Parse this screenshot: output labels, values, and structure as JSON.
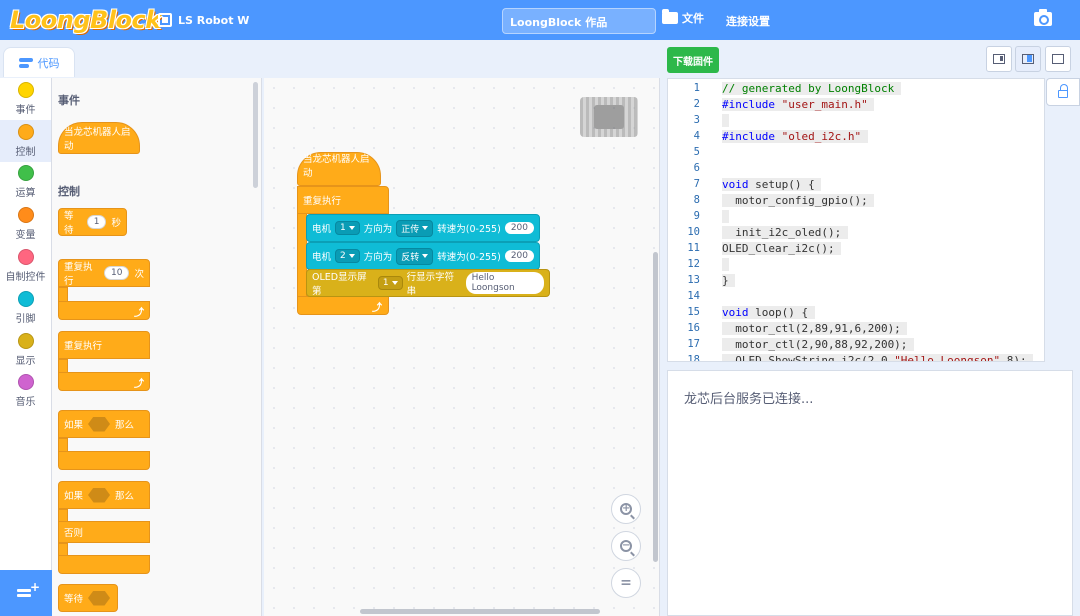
{
  "header": {
    "logo": "LoongBlock",
    "device": "LS Robot W",
    "project_title": "LoongBlock 作品",
    "file_label": "文件",
    "connect_label": "连接设置"
  },
  "tabs": {
    "code": "代码"
  },
  "categories": [
    {
      "label": "事件",
      "color": "#ffd500"
    },
    {
      "label": "控制",
      "color": "#ffab19"
    },
    {
      "label": "运算",
      "color": "#40bf4a"
    },
    {
      "label": "变量",
      "color": "#ff8c1a"
    },
    {
      "label": "自制控件",
      "color": "#ff6680"
    },
    {
      "label": "引脚",
      "color": "#0fbcd6"
    },
    {
      "label": "显示",
      "color": "#d9b11a"
    },
    {
      "label": "音乐",
      "color": "#cf63cf"
    }
  ],
  "palette": {
    "events_heading": "事件",
    "when_start": "当龙芯机器人启动",
    "control_heading": "控制",
    "wait_label": "等待",
    "wait_value": "1",
    "wait_unit": "秒",
    "repeat_label": "重复执行",
    "repeat_count": "10",
    "repeat_unit": "次",
    "forever_label": "重复执行",
    "if_label": "如果",
    "then_label": "那么",
    "if_else_if": "如果",
    "if_else_then": "那么",
    "else_label": "否则",
    "wait_until": "等待"
  },
  "workspace": {
    "hat": "当龙芯机器人启动",
    "forever": "重复执行",
    "motor1": {
      "label": "电机",
      "port": "1",
      "dir_label": "方向为",
      "dir": "正传",
      "speed_label": "转速为(0-255)",
      "speed": "200"
    },
    "motor2": {
      "label": "电机",
      "port": "2",
      "dir_label": "方向为",
      "dir": "反转",
      "speed_label": "转速为(0-255)",
      "speed": "200"
    },
    "oled": {
      "label": "OLED显示屏第",
      "line": "1",
      "suffix": "行显示字符串",
      "text": "Hello Loongson"
    }
  },
  "right": {
    "download": "下载固件",
    "console_text": "龙芯后台服务已连接..."
  },
  "code": {
    "line_numbers": [
      "1",
      "2",
      "3",
      "4",
      "5",
      "6",
      "7",
      "8",
      "9",
      "10",
      "11",
      "12",
      "13",
      "14",
      "15",
      "16",
      "17",
      "18"
    ]
  }
}
